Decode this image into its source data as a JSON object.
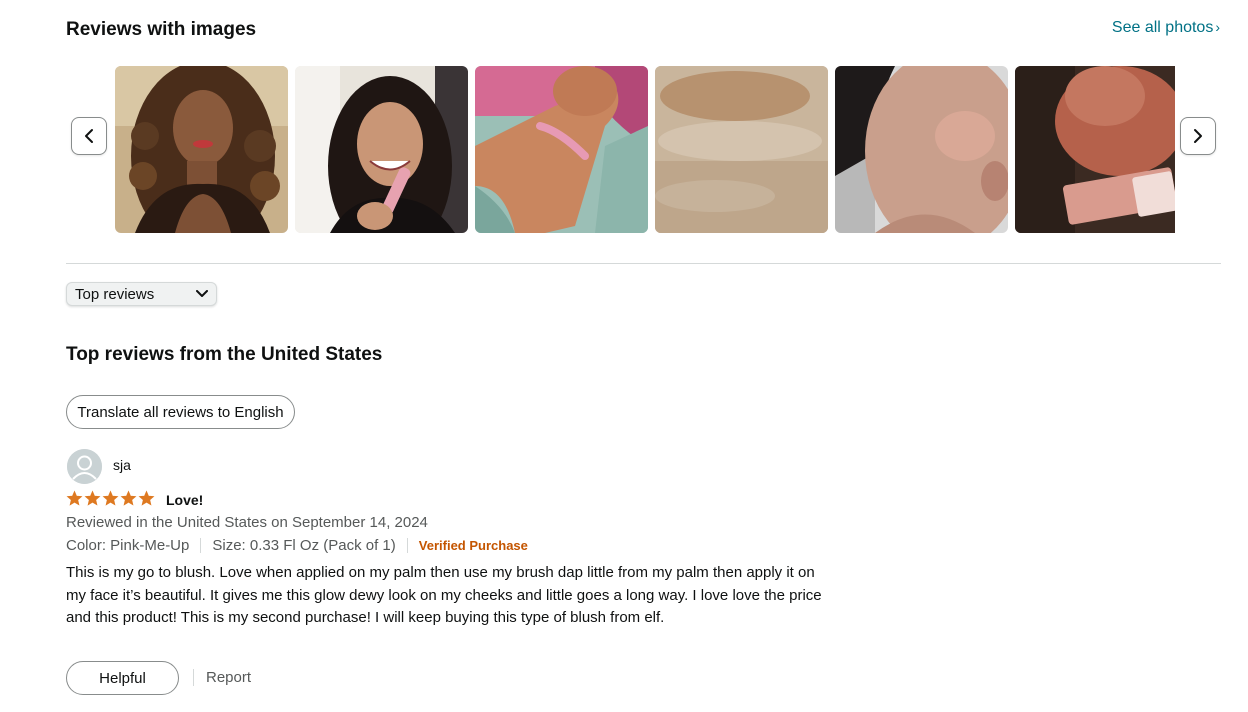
{
  "gallery": {
    "title": "Reviews with images",
    "see_all_label": "See all photos",
    "prev_icon": "chevron-left-icon",
    "next_icon": "chevron-right-icon",
    "images": [
      {
        "icon": "review-photo-woman-curly-hair"
      },
      {
        "icon": "review-photo-woman-holding-product"
      },
      {
        "icon": "review-photo-arm-swatch"
      },
      {
        "icon": "review-photo-skin-swatch-closeup"
      },
      {
        "icon": "review-photo-cheek-closeup"
      },
      {
        "icon": "review-photo-hand-with-product-tube"
      }
    ]
  },
  "sort": {
    "selected": "Top reviews"
  },
  "reviews_section": {
    "title": "Top reviews from the United States",
    "translate_label": "Translate all reviews to English"
  },
  "review": {
    "reviewer": "sja",
    "rating": 5,
    "star_color": "#de7921",
    "title": "Love!",
    "date": "Reviewed in the United States on September 14, 2024",
    "color": "Color: Pink-Me-Up",
    "size": "Size: 0.33 Fl Oz (Pack of 1)",
    "verified": "Verified Purchase",
    "body": "This is my go to blush. Love when applied on my palm then use my brush dap little from my palm then apply it on my face it’s beautiful. It gives me this glow dewy look on my cheeks and little goes a long way. I love love the price and this product! This is my second purchase! I will keep buying this type of blush from elf.",
    "helpful_label": "Helpful",
    "report_label": "Report"
  },
  "colors": {
    "link": "#007185",
    "verified": "#c45500",
    "muted_text": "#565959"
  }
}
